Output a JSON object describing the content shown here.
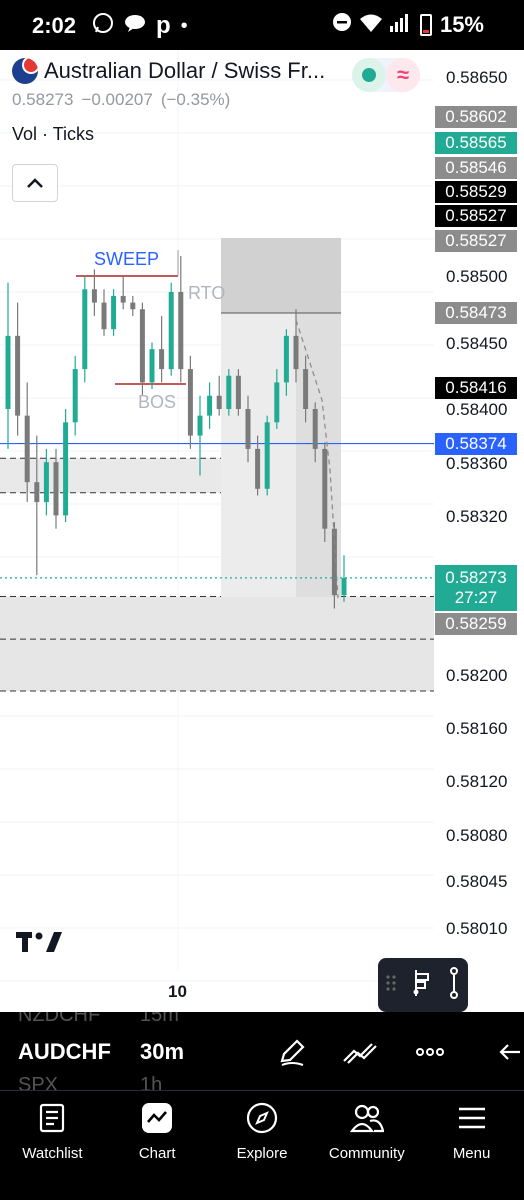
{
  "status_bar": {
    "time": "2:02",
    "battery": "15%",
    "icons": [
      "whatsapp-icon",
      "chat-icon",
      "p-icon",
      "dot-icon",
      "dnd-icon",
      "wifi-icon",
      "signal-icon",
      "battery-icon"
    ]
  },
  "header": {
    "symbol_title": "Australian Dollar / Swiss Fr...",
    "last_price": "0.58273",
    "change": "−0.00207",
    "change_pct": "(−0.35%)",
    "indicator": "Vol · Ticks"
  },
  "annotations": {
    "sweep": "SWEEP",
    "rto": "RTO",
    "bos": "BOS"
  },
  "y_axis": {
    "labels": [
      "0.58650",
      "0.58500",
      "0.58450",
      "0.58400",
      "0.58360",
      "0.58320",
      "0.58200",
      "0.58160",
      "0.58120",
      "0.58080",
      "0.58045",
      "0.58010"
    ]
  },
  "price_tags": [
    {
      "value": "0.58602",
      "style": "grey"
    },
    {
      "value": "0.58565",
      "style": "teal"
    },
    {
      "value": "0.58546",
      "style": "grey"
    },
    {
      "value": "0.58529",
      "style": "black"
    },
    {
      "value": "0.58527",
      "style": "black"
    },
    {
      "value": "0.58527",
      "style": "grey"
    },
    {
      "value": "0.58473",
      "style": "grey"
    },
    {
      "value": "0.58416",
      "style": "black"
    },
    {
      "value": "0.58374",
      "style": "blue"
    },
    {
      "value": "0.58259",
      "style": "grey"
    }
  ],
  "current_price": {
    "value": "0.58273",
    "countdown": "27:27"
  },
  "x_axis": {
    "label": "10"
  },
  "colors": {
    "up": "#22ab94",
    "down": "#7a7a7a",
    "horizontal_line": "#2962ff",
    "sweep_line": "#b22222"
  },
  "toolbar": {
    "symbol": "AUDCHF",
    "timeframe": "30m",
    "prev_symbol": "NZDCHF",
    "prev_timeframe": "15m",
    "next_symbol": "SPX",
    "next_timeframe": "1h",
    "icons": [
      "pencil-icon",
      "trend-icon",
      "more-icon",
      "back-icon"
    ]
  },
  "nav": [
    {
      "label": "Watchlist",
      "icon": "watchlist-icon"
    },
    {
      "label": "Chart",
      "icon": "chart-icon"
    },
    {
      "label": "Explore",
      "icon": "compass-icon"
    },
    {
      "label": "Community",
      "icon": "community-icon"
    },
    {
      "label": "Menu",
      "icon": "menu-icon"
    }
  ],
  "chart_data": {
    "type": "candlestick",
    "symbol": "AUDCHF",
    "timeframe": "30m",
    "candles": [
      {
        "o": 0.584,
        "h": 0.58495,
        "l": 0.5837,
        "c": 0.58455
      },
      {
        "o": 0.58455,
        "h": 0.5848,
        "l": 0.5838,
        "c": 0.58395
      },
      {
        "o": 0.58395,
        "h": 0.5842,
        "l": 0.5833,
        "c": 0.58345
      },
      {
        "o": 0.58345,
        "h": 0.5838,
        "l": 0.58275,
        "c": 0.5833
      },
      {
        "o": 0.5833,
        "h": 0.5837,
        "l": 0.5832,
        "c": 0.5836
      },
      {
        "o": 0.5836,
        "h": 0.5837,
        "l": 0.5831,
        "c": 0.5832
      },
      {
        "o": 0.5832,
        "h": 0.584,
        "l": 0.58315,
        "c": 0.5839
      },
      {
        "o": 0.5839,
        "h": 0.5844,
        "l": 0.5838,
        "c": 0.5843
      },
      {
        "o": 0.5843,
        "h": 0.585,
        "l": 0.5842,
        "c": 0.5849
      },
      {
        "o": 0.5849,
        "h": 0.58505,
        "l": 0.5847,
        "c": 0.5848
      },
      {
        "o": 0.5848,
        "h": 0.5849,
        "l": 0.58455,
        "c": 0.5846
      },
      {
        "o": 0.5846,
        "h": 0.5849,
        "l": 0.58455,
        "c": 0.58485
      },
      {
        "o": 0.58485,
        "h": 0.585,
        "l": 0.58475,
        "c": 0.5848
      },
      {
        "o": 0.5848,
        "h": 0.58485,
        "l": 0.5847,
        "c": 0.58475
      },
      {
        "o": 0.58475,
        "h": 0.5848,
        "l": 0.5841,
        "c": 0.5842
      },
      {
        "o": 0.5842,
        "h": 0.5845,
        "l": 0.58415,
        "c": 0.58445
      },
      {
        "o": 0.58445,
        "h": 0.5847,
        "l": 0.5842,
        "c": 0.5843
      },
      {
        "o": 0.5843,
        "h": 0.58495,
        "l": 0.58425,
        "c": 0.58488
      },
      {
        "o": 0.58488,
        "h": 0.58515,
        "l": 0.5842,
        "c": 0.5843
      },
      {
        "o": 0.5843,
        "h": 0.5844,
        "l": 0.5837,
        "c": 0.5838
      },
      {
        "o": 0.5838,
        "h": 0.5841,
        "l": 0.5835,
        "c": 0.58395
      },
      {
        "o": 0.58395,
        "h": 0.5842,
        "l": 0.58385,
        "c": 0.5841
      },
      {
        "o": 0.5841,
        "h": 0.58425,
        "l": 0.58395,
        "c": 0.584
      },
      {
        "o": 0.584,
        "h": 0.5843,
        "l": 0.58395,
        "c": 0.58425
      },
      {
        "o": 0.58425,
        "h": 0.5843,
        "l": 0.58395,
        "c": 0.584
      },
      {
        "o": 0.584,
        "h": 0.5841,
        "l": 0.5836,
        "c": 0.5837
      },
      {
        "o": 0.5837,
        "h": 0.5838,
        "l": 0.58335,
        "c": 0.5834
      },
      {
        "o": 0.5834,
        "h": 0.58395,
        "l": 0.58335,
        "c": 0.5839
      },
      {
        "o": 0.5839,
        "h": 0.5843,
        "l": 0.58385,
        "c": 0.5842
      },
      {
        "o": 0.5842,
        "h": 0.5846,
        "l": 0.5841,
        "c": 0.58455
      },
      {
        "o": 0.58455,
        "h": 0.58475,
        "l": 0.5842,
        "c": 0.5843
      },
      {
        "o": 0.5843,
        "h": 0.5844,
        "l": 0.5839,
        "c": 0.584
      },
      {
        "o": 0.584,
        "h": 0.58405,
        "l": 0.5836,
        "c": 0.5837
      },
      {
        "o": 0.5837,
        "h": 0.58375,
        "l": 0.583,
        "c": 0.5831
      },
      {
        "o": 0.5831,
        "h": 0.58315,
        "l": 0.5825,
        "c": 0.5826
      },
      {
        "o": 0.5826,
        "h": 0.5829,
        "l": 0.58255,
        "c": 0.58273
      }
    ],
    "y_range": [
      0.58,
      0.5866
    ],
    "horizontal_line": 0.58374,
    "current_price": 0.58273
  }
}
